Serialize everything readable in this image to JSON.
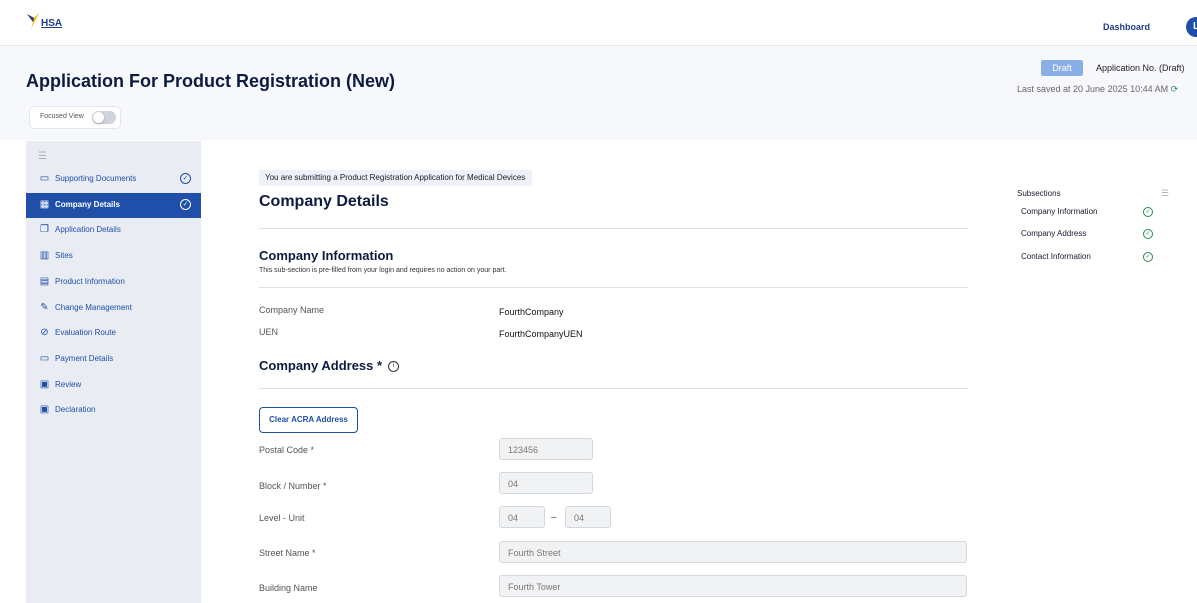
{
  "topbar": {
    "logo_text": "HSA",
    "dashboard_link": "Dashboard",
    "avatar_initial": "L"
  },
  "header": {
    "title": "Application For Product Registration (New)",
    "focused_view_label": "Focused View",
    "focused_view_on": false,
    "status_badge": "Draft",
    "application_no": "Application No. (Draft)",
    "last_saved": "Last saved at 20 June 2025 10:44 AM"
  },
  "sidebar": {
    "items": [
      {
        "label": "Supporting Documents",
        "icon": "folder-icon",
        "active": false,
        "complete": true
      },
      {
        "label": "Company Details",
        "icon": "building-icon",
        "active": true,
        "complete": true
      },
      {
        "label": "Application Details",
        "icon": "copy-icon",
        "active": false,
        "complete": false
      },
      {
        "label": "Sites",
        "icon": "buildings-icon",
        "active": false,
        "complete": false
      },
      {
        "label": "Product Information",
        "icon": "box-icon",
        "active": false,
        "complete": false
      },
      {
        "label": "Change Management",
        "icon": "edit-icon",
        "active": false,
        "complete": false
      },
      {
        "label": "Evaluation Route",
        "icon": "check-circle-icon",
        "active": false,
        "complete": false
      },
      {
        "label": "Payment Details",
        "icon": "credit-card-icon",
        "active": false,
        "complete": false
      },
      {
        "label": "Review",
        "icon": "document-icon",
        "active": false,
        "complete": false
      },
      {
        "label": "Declaration",
        "icon": "document-icon",
        "active": false,
        "complete": false
      }
    ]
  },
  "main": {
    "banner": "You are submitting a Product Registration Application for Medical Devices",
    "section_title": "Company Details",
    "company_info": {
      "title": "Company Information",
      "description": "This sub-section is pre-filled from your login and requires no action on your part.",
      "fields": [
        {
          "label": "Company Name",
          "value": "FourthCompany"
        },
        {
          "label": "UEN",
          "value": "FourthCompanyUEN"
        }
      ]
    },
    "company_address": {
      "title": "Company Address *",
      "clear_button": "Clear ACRA Address",
      "postal_code_label": "Postal Code *",
      "postal_code_value": "123456",
      "block_label": "Block / Number *",
      "block_value": "04",
      "level_unit_label": "Level - Unit",
      "level_value": "04",
      "unit_value": "04",
      "level_unit_separator": "–",
      "street_label": "Street Name *",
      "street_value": "Fourth Street",
      "building_label": "Building Name",
      "building_value": "Fourth Tower"
    }
  },
  "subsections": {
    "title": "Subsections",
    "items": [
      {
        "label": "Company Information",
        "complete": true
      },
      {
        "label": "Company Address",
        "complete": true
      },
      {
        "label": "Contact Information",
        "complete": true
      }
    ]
  },
  "colors": {
    "primary": "#1f4fa8",
    "draft_badge": "#8aaee6",
    "success": "#2e8b57",
    "sidebar_bg": "#e9ecf2"
  }
}
